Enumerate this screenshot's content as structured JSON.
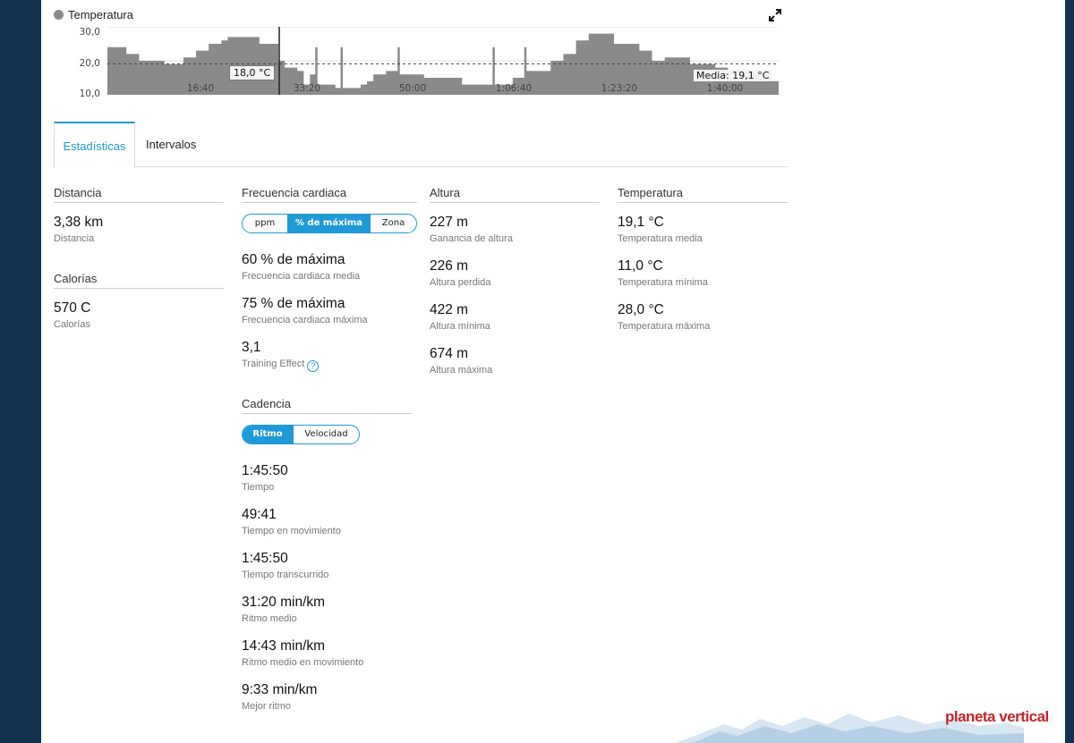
{
  "chart": {
    "legend": "Temperatura",
    "y_ticks": [
      "30,0",
      "20,0",
      "10,0"
    ],
    "x_ticks": [
      "16:40",
      "33:20",
      "50:00",
      "1:06:40",
      "1:23:20",
      "1:40:00"
    ],
    "tooltip": "18,0 °C",
    "average_label": "Media: 19,1 °C",
    "series_color": "#8a8a8a"
  },
  "chart_data": {
    "type": "area",
    "title": "",
    "series": [
      {
        "name": "Temperatura",
        "values": []
      }
    ],
    "x_minutes": [
      0,
      3,
      5,
      9,
      12,
      14,
      16,
      18,
      19,
      21,
      24,
      27,
      28,
      30,
      31,
      32,
      33,
      34,
      36,
      38,
      40,
      41,
      42,
      44,
      46,
      48,
      50,
      52,
      56,
      60,
      64,
      66,
      70,
      72,
      74,
      76,
      80,
      84,
      86,
      88,
      92,
      96,
      98,
      100,
      102,
      104,
      106,
      106
    ],
    "y_values": [
      24,
      22,
      20,
      19,
      21,
      23,
      25,
      26,
      27,
      27,
      25,
      20,
      18,
      17,
      13,
      16,
      13,
      13,
      12,
      12,
      13,
      14,
      16,
      17,
      16,
      16,
      15,
      15,
      13,
      13,
      15,
      17,
      20,
      22,
      26,
      28,
      25,
      23,
      20,
      21,
      19,
      18,
      17,
      17,
      15,
      14,
      14,
      14
    ],
    "ylim": [
      10,
      30
    ],
    "average": 19.1,
    "cursor_value": 18.0,
    "x_tick_labels": [
      "16:40",
      "33:20",
      "50:00",
      "1:06:40",
      "1:23:20",
      "1:40:00"
    ],
    "y_tick_labels": [
      "30,0",
      "20,0",
      "10,0"
    ],
    "grid": true
  },
  "tabs": {
    "active": "Estadísticas",
    "other": "Intervalos"
  },
  "distancia": {
    "header": "Distancia",
    "value": "3,38 km",
    "label": "Distancia"
  },
  "calorias": {
    "header": "Calorías",
    "value": "570 C",
    "label": "Calorías"
  },
  "fc": {
    "header": "Frecuencia cardiaca",
    "seg": [
      "ppm",
      "% de máxima",
      "Zona"
    ],
    "media_v": "60 % de máxima",
    "media_l": "Frecuencia cardiaca media",
    "max_v": "75 % de máxima",
    "max_l": "Frecuencia cardiaca máxima",
    "te_v": "3,1",
    "te_l": "Training Effect"
  },
  "cadencia": {
    "header": "Cadencia",
    "seg": [
      "Ritmo",
      "Velocidad"
    ],
    "items": [
      {
        "v": "1:45:50",
        "l": "Tiempo"
      },
      {
        "v": "49:41",
        "l": "Tiempo en movimiento"
      },
      {
        "v": "1:45:50",
        "l": "Tiempo transcurrido"
      },
      {
        "v": "31:20 min/km",
        "l": "Ritmo medio"
      },
      {
        "v": "14:43 min/km",
        "l": "Ritmo medio en movimiento"
      },
      {
        "v": "9:33 min/km",
        "l": "Mejor ritmo"
      }
    ]
  },
  "altura": {
    "header": "Altura",
    "items": [
      {
        "v": "227 m",
        "l": "Ganancia de altura"
      },
      {
        "v": "226 m",
        "l": "Altura perdida"
      },
      {
        "v": "422 m",
        "l": "Altura mínima"
      },
      {
        "v": "674 m",
        "l": "Altura máxima"
      }
    ]
  },
  "temperatura": {
    "header": "Temperatura",
    "items": [
      {
        "v": "19,1 °C",
        "l": "Temperatura media"
      },
      {
        "v": "11,0 °C",
        "l": "Temperatura mínima"
      },
      {
        "v": "28,0 °C",
        "l": "Temperatura máxima"
      }
    ]
  },
  "brand": "planeta vertical",
  "accent": "#1f9ad6"
}
